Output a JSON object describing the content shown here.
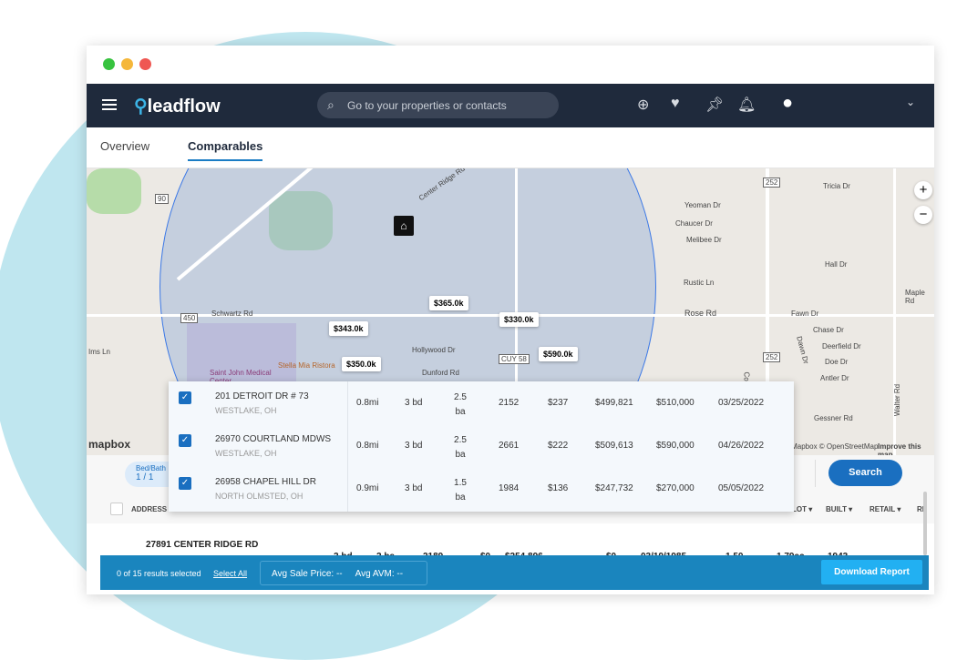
{
  "app": {
    "logo": "leadflow",
    "search_placeholder": "Go to your properties or contacts"
  },
  "nav_icons": [
    "plus-circle-icon",
    "heart-icon",
    "pin-icon",
    "bell-icon",
    "user-icon",
    "chevron-down-icon"
  ],
  "tabs": [
    {
      "label": "Overview"
    },
    {
      "label": "Comparables"
    }
  ],
  "map": {
    "labels": [
      "Center Ridge Rd",
      "Schwartz Rd",
      "Hollywood Dr",
      "Dunford Rd",
      "Stella Mia Ristora",
      "Saint John Medical Center",
      "Yeoman Dr",
      "Chaucer Dr",
      "Melibee Dr",
      "Rustic Ln",
      "Rose Rd",
      "Hall Dr",
      "Tricia Dr",
      "Maple Rd",
      "Fawn Dr",
      "Chase Dr",
      "Deerfield Dr",
      "Doe Dr",
      "Antler Dr",
      "Gessner Rd",
      "Walter Rd",
      "Dawn Dr",
      "Col",
      "Ims Ln",
      "450",
      "252",
      "CUY 58",
      "90"
    ],
    "pins": [
      "$365.0k",
      "$330.0k",
      "$343.0k",
      "$590.0k",
      "$350.0k"
    ],
    "attribution": "© Mapbox © OpenStreetMap",
    "improve": "Improve this map",
    "brand": "mapbox",
    "zoom_in": "+",
    "zoom_out": "−"
  },
  "popup_rows": [
    {
      "address": "201 DETROIT DR # 73",
      "city": "WESTLAKE, OH",
      "dist": "0.8mi",
      "beds": "3 bd",
      "baths": "2.5",
      "ba": "ba",
      "sqft": "2152",
      "ppsf": "$237",
      "avm": "$499,821",
      "price": "$510,000",
      "date": "03/25/2022"
    },
    {
      "address": "26970 COURTLAND MDWS",
      "city": "WESTLAKE, OH",
      "dist": "0.8mi",
      "beds": "3 bd",
      "baths": "2.5",
      "ba": "ba",
      "sqft": "2661",
      "ppsf": "$222",
      "avm": "$509,613",
      "price": "$590,000",
      "date": "04/26/2022"
    },
    {
      "address": "26958 CHAPEL HILL DR",
      "city": "NORTH OLMSTED, OH",
      "dist": "0.9mi",
      "beds": "3 bd",
      "baths": "1.5",
      "ba": "ba",
      "sqft": "1984",
      "ppsf": "$136",
      "avm": "$247,732",
      "price": "$270,000",
      "date": "05/05/2022"
    }
  ],
  "filters": {
    "chip_label": "Bed/Bath",
    "chip_value": "1 / 1",
    "search": "Search"
  },
  "table": {
    "headers": [
      "ADDRESS",
      "LOT ▾",
      "BUILT ▾",
      "RETAIL ▾",
      "RE"
    ],
    "row": {
      "address": "27891 CENTER RIDGE RD",
      "c1": "---",
      "beds": "2 bd",
      "baths": "2 ba",
      "sqft": "2189",
      "v1": "$0",
      "v2": "$254,896",
      "v3": "$0",
      "date": "03/19/1985",
      "v4": "1.50",
      "lot": "1.79ac",
      "built": "1943"
    }
  },
  "bottom": {
    "selected": "0 of 15 results selected",
    "select_all": "Select All",
    "avg_sale": "Avg Sale Price: --",
    "avg_avm": "Avg AVM: --",
    "download": "Download Report"
  },
  "colors": {
    "nav": "#1f2a3c",
    "accent": "#1a6fc0",
    "bottom_bar": "#1a85be",
    "logo_accent": "#3cb4e6"
  }
}
